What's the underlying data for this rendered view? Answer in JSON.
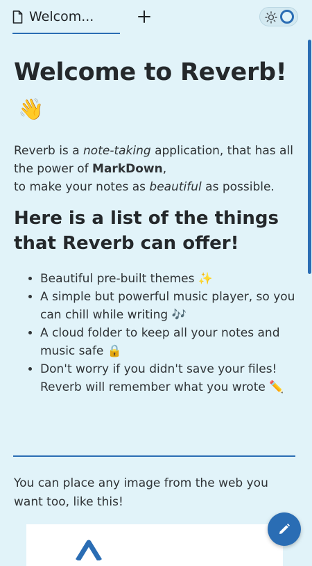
{
  "tab": {
    "title": "Welcom..."
  },
  "content": {
    "title": "Welcome to Reverb!",
    "title_emoji": "👋",
    "intro": {
      "p1": "Reverb is a ",
      "em1": "note-taking",
      "p2": " application, that has all the power of ",
      "strong1": "MarkDown",
      "p3": ",",
      "p4": "to make your notes as ",
      "em2": "beautiful",
      "p5": " as possible."
    },
    "subtitle": "Here is a list of the things that Reverb can offer!",
    "features": [
      "Beautiful pre-built themes ✨",
      "A simple but powerful music player, so you can chill while writing 🎶",
      "A cloud folder to keep all your notes and music safe 🔒",
      "Don't worry if you didn't save your files! Reverb will remember what you wrote ✏️"
    ],
    "image_caption": "You can place any image from the web you want too, like this!"
  },
  "colors": {
    "accent": "#2a6db4",
    "background": "#e1f3f9",
    "text": "#26292b"
  },
  "icons": {
    "tab": "document-icon",
    "new_tab": "plus-icon",
    "theme": "sun-icon",
    "fab": "pencil-icon"
  }
}
